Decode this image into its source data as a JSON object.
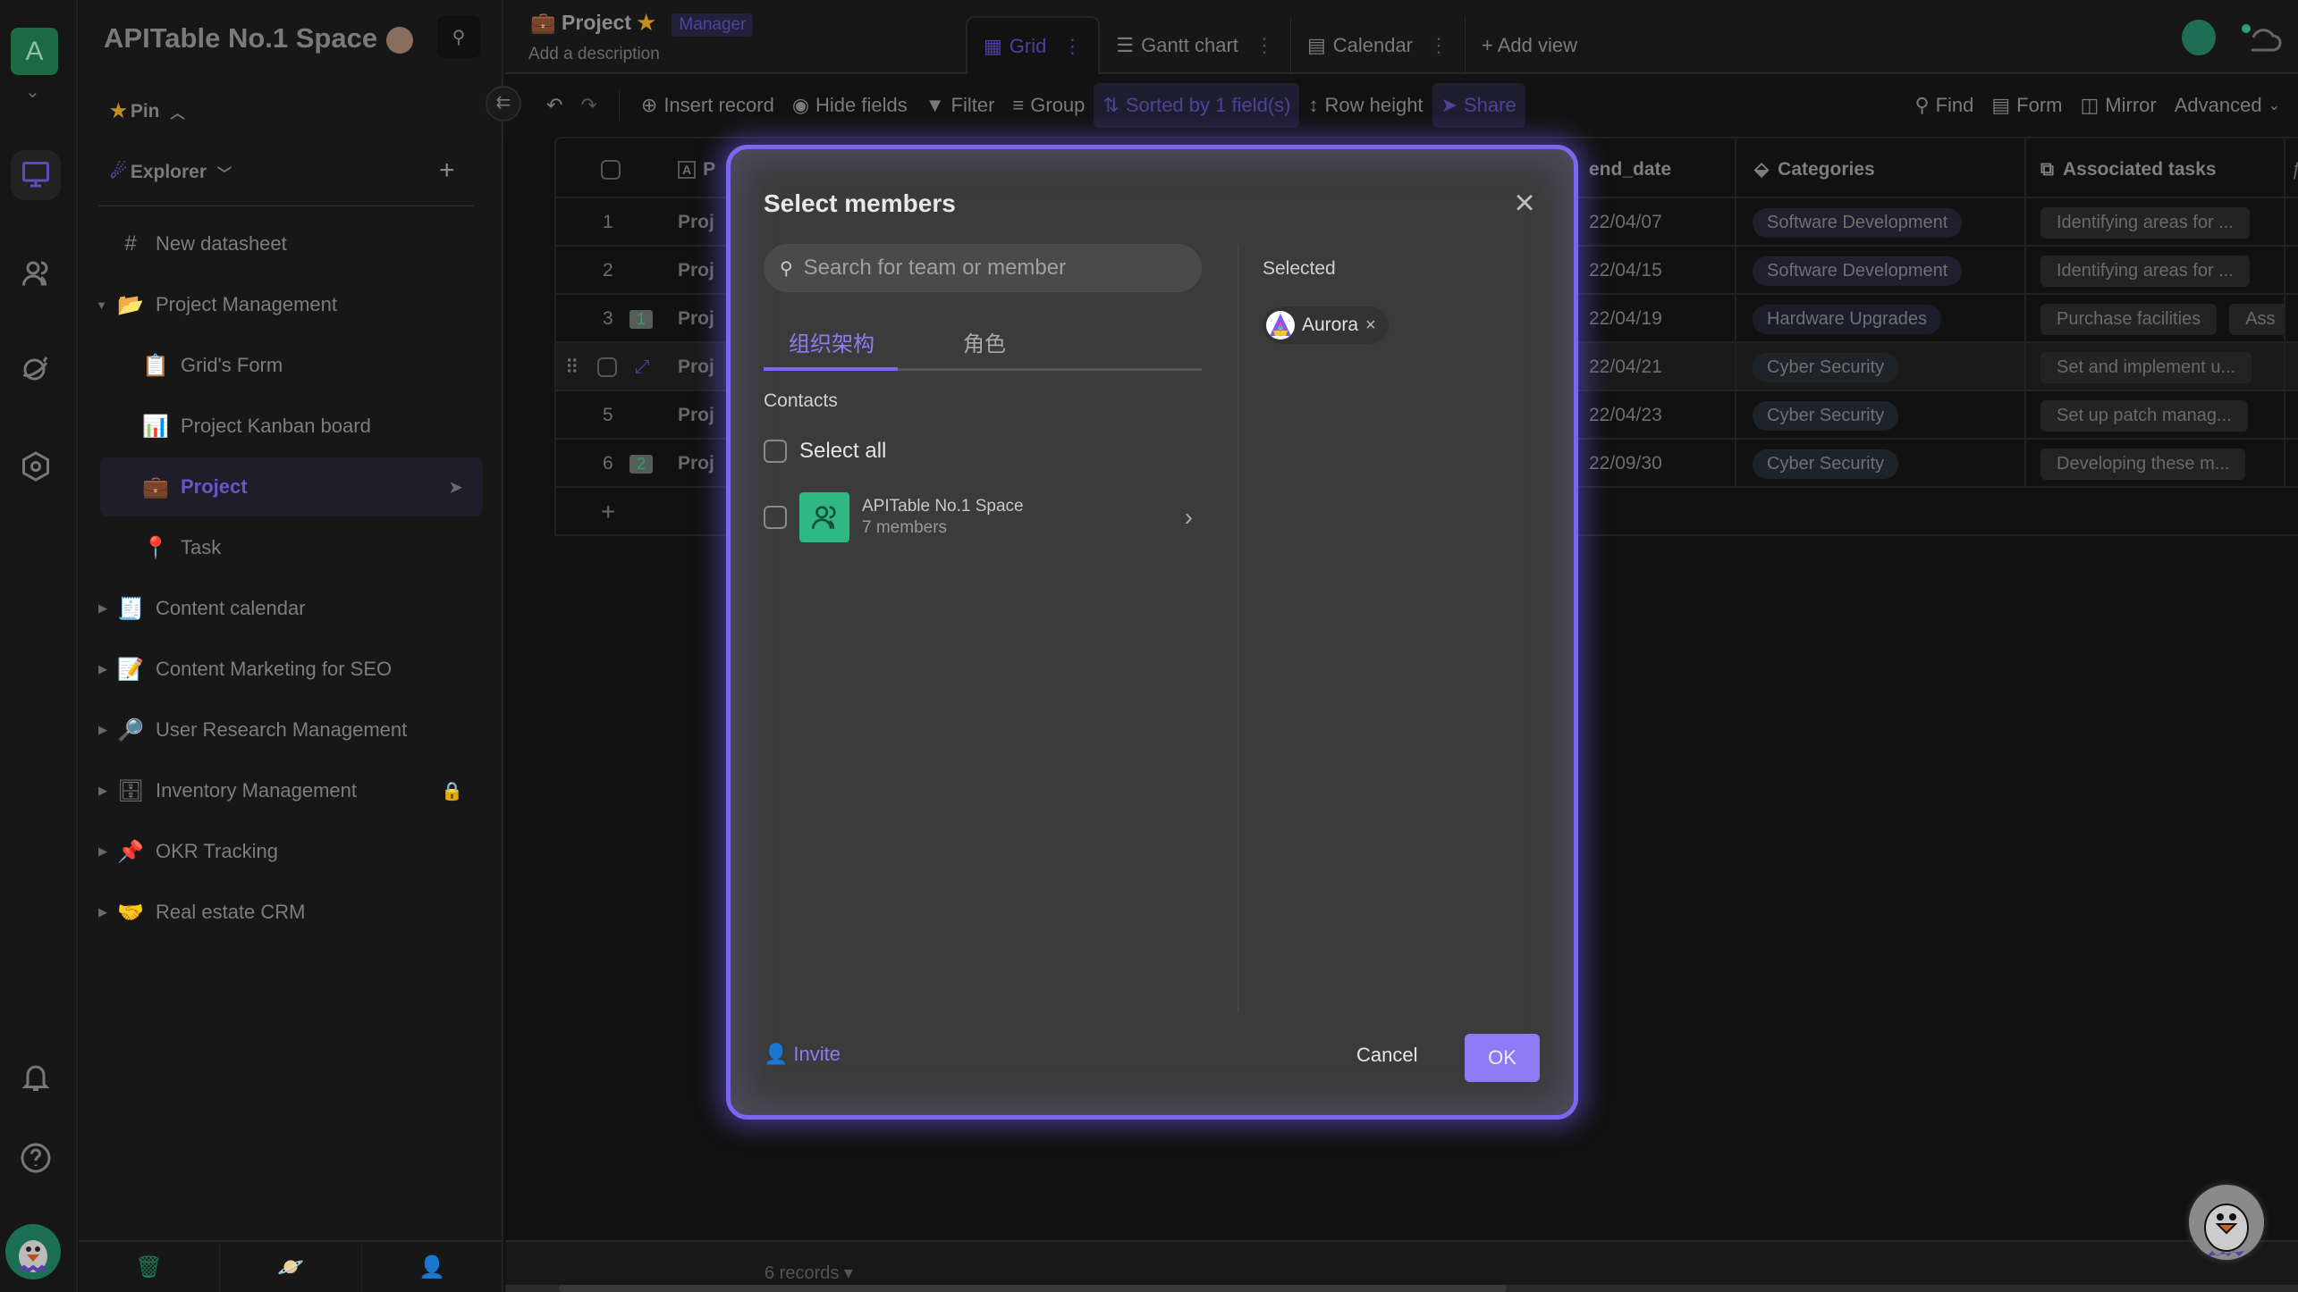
{
  "rail": {
    "workspace_initial": "A",
    "icons": [
      "workbench-icon",
      "contacts-icon",
      "explore-planet-icon",
      "settings-hexagon-icon",
      "bell-icon",
      "help-icon"
    ]
  },
  "sidebar": {
    "space_title": "APITable No.1 Space",
    "pin_label": "Pin",
    "explorer_label": "Explorer",
    "items": [
      {
        "label": "New datasheet",
        "emoji": "#",
        "indent": 1,
        "expander": "",
        "trail": ""
      },
      {
        "label": "Project Management",
        "emoji": "📂",
        "indent": 1,
        "expander": "▼",
        "trail": ""
      },
      {
        "label": "Grid's Form",
        "emoji": "📋",
        "indent": 2,
        "expander": "",
        "trail": ""
      },
      {
        "label": "Project Kanban board",
        "emoji": "📊",
        "indent": 2,
        "expander": "",
        "trail": ""
      },
      {
        "label": "Project",
        "emoji": "💼",
        "indent": 2,
        "expander": "",
        "trail": "➤",
        "active": true
      },
      {
        "label": "Task",
        "emoji": "📍",
        "indent": 2,
        "expander": "",
        "trail": ""
      },
      {
        "label": "Content calendar",
        "emoji": "🧾",
        "indent": 1,
        "expander": "▶",
        "trail": ""
      },
      {
        "label": "Content Marketing for SEO",
        "emoji": "📝",
        "indent": 1,
        "expander": "▶",
        "trail": ""
      },
      {
        "label": "User Research Management",
        "emoji": "🔎",
        "indent": 1,
        "expander": "▶",
        "trail": ""
      },
      {
        "label": "Inventory Management",
        "emoji": "🗄",
        "indent": 1,
        "expander": "▶",
        "trail": "🔒"
      },
      {
        "label": "OKR Tracking",
        "emoji": "📌",
        "indent": 1,
        "expander": "▶",
        "trail": ""
      },
      {
        "label": "Real estate CRM",
        "emoji": "🤝",
        "indent": 1,
        "expander": "▶",
        "trail": ""
      }
    ]
  },
  "header": {
    "title": "Project",
    "role_badge": "Manager",
    "description_placeholder": "Add a description",
    "views": [
      {
        "label": "Grid",
        "active": true
      },
      {
        "label": "Gantt chart"
      },
      {
        "label": "Calendar"
      }
    ],
    "add_view_label": "+ Add view"
  },
  "toolbar": {
    "insert_record": "Insert record",
    "hide_fields": "Hide fields",
    "filter": "Filter",
    "group": "Group",
    "sorted": "Sorted by 1 field(s)",
    "row_height": "Row height",
    "share": "Share",
    "find": "Find",
    "form": "Form",
    "mirror": "Mirror",
    "advanced": "Advanced"
  },
  "grid": {
    "columns": {
      "primary": "P",
      "end_date": "end_date",
      "categories": "Categories",
      "associated_tasks": "Associated tasks"
    },
    "rows": [
      {
        "num": "1",
        "primary": "Proj",
        "end_date": "22/04/07",
        "category": "Software Development",
        "cat_class": "sd",
        "tasks": [
          "Identifying areas for ..."
        ],
        "comments": ""
      },
      {
        "num": "2",
        "primary": "Proj",
        "end_date": "22/04/15",
        "category": "Software Development",
        "cat_class": "sd",
        "tasks": [
          "Identifying areas for ..."
        ],
        "comments": ""
      },
      {
        "num": "3",
        "primary": "Proj",
        "end_date": "22/04/19",
        "category": "Hardware Upgrades",
        "cat_class": "hw",
        "tasks": [
          "Purchase facilities",
          "Ass"
        ],
        "comments": "1"
      },
      {
        "num": "",
        "primary": "Proj",
        "end_date": "22/04/21",
        "category": "Cyber Security",
        "cat_class": "cs",
        "tasks": [
          "Set and implement u..."
        ],
        "comments": "",
        "hovered": true
      },
      {
        "num": "5",
        "primary": "Proj",
        "end_date": "22/04/23",
        "category": "Cyber Security",
        "cat_class": "cs",
        "tasks": [
          "Set up patch manag..."
        ],
        "comments": ""
      },
      {
        "num": "6",
        "primary": "Proj",
        "end_date": "22/09/30",
        "category": "Cyber Security",
        "cat_class": "cs",
        "tasks": [
          "Developing these m..."
        ],
        "comments": "2"
      }
    ],
    "add_row": "+"
  },
  "footer": {
    "records": "6 records ▾"
  },
  "modal": {
    "title": "Select members",
    "search_placeholder": "Search for team or member",
    "tabs": [
      {
        "label": "组织架构",
        "active": true
      },
      {
        "label": "角色"
      }
    ],
    "contacts_label": "Contacts",
    "select_all": "Select all",
    "team": {
      "name": "APITable No.1 Space",
      "count": "7 members"
    },
    "selected_label": "Selected",
    "selected": [
      {
        "name": "Aurora"
      }
    ],
    "invite": "Invite",
    "cancel": "Cancel",
    "ok": "OK"
  },
  "colors": {
    "accent": "#7b67ee",
    "modal_bg": "#3b3b3b",
    "team_icon": "#2fb883"
  }
}
